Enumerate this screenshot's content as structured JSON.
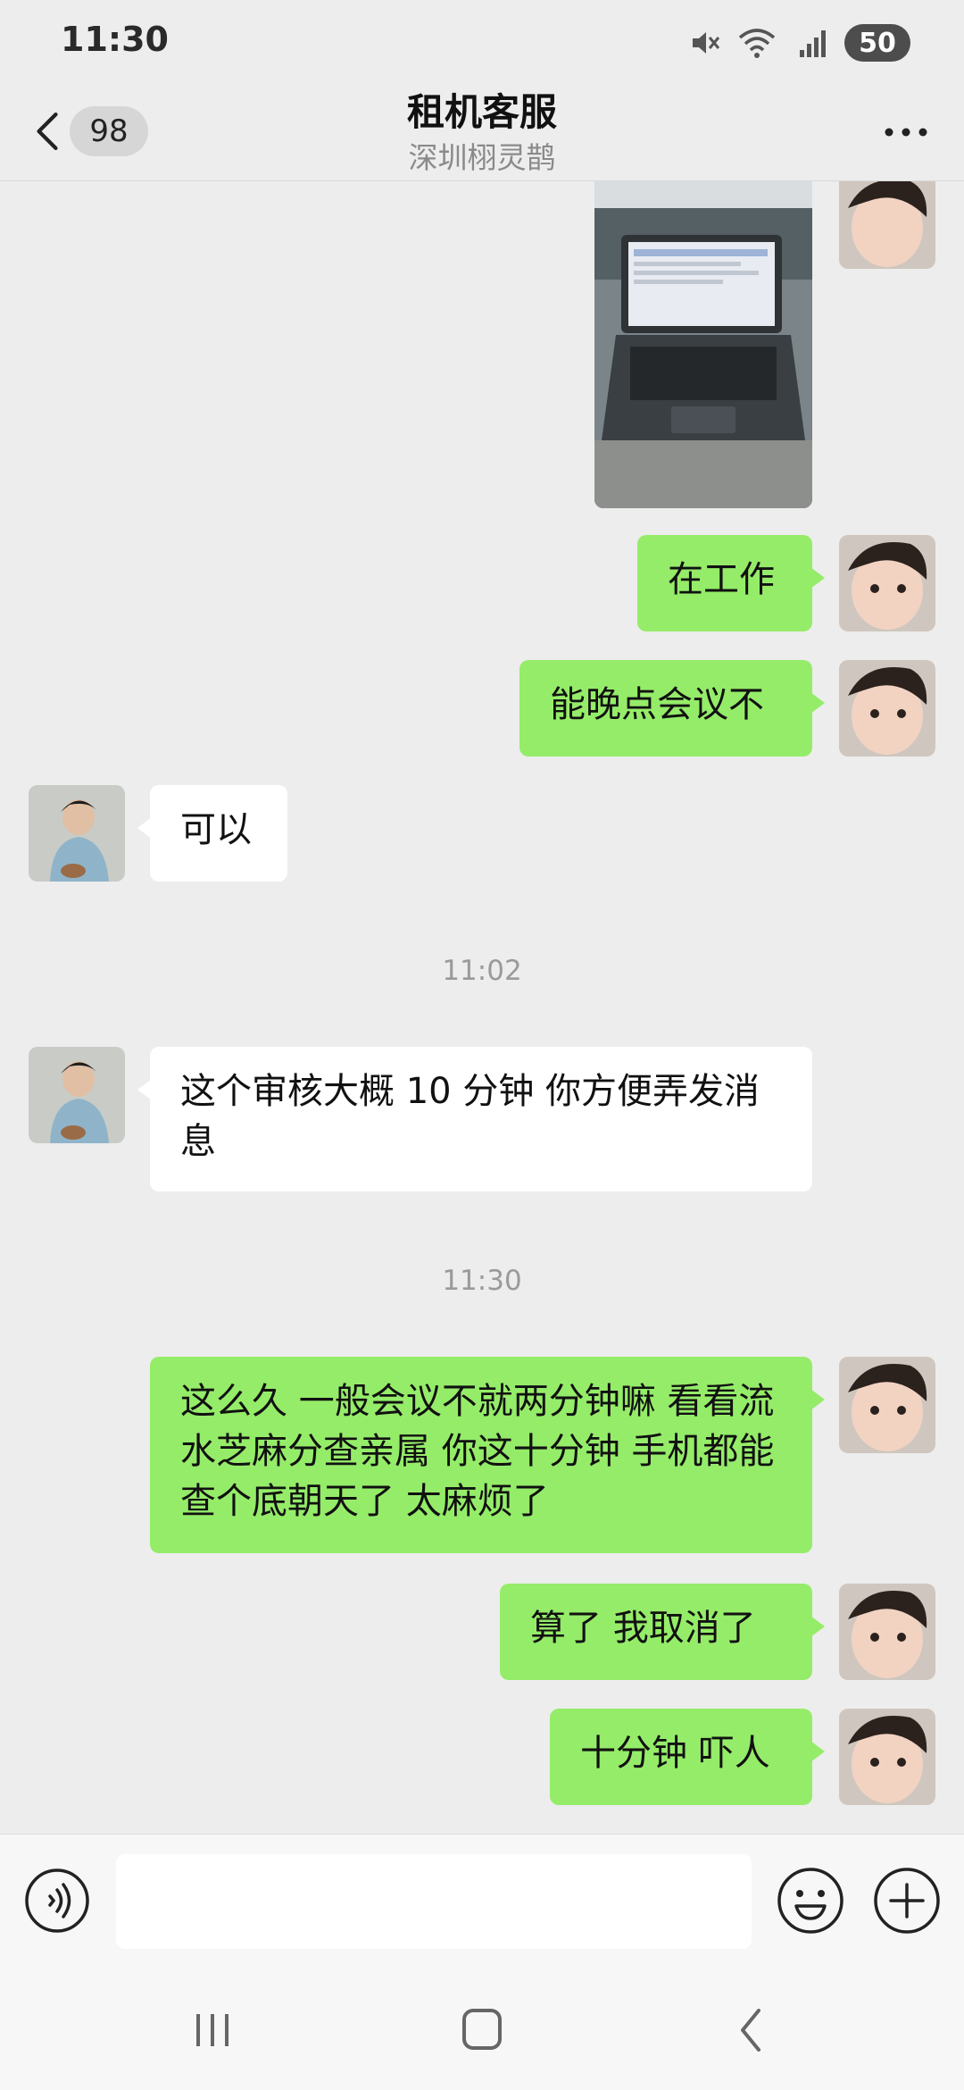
{
  "status_bar": {
    "time": "11:30",
    "battery_level": "50",
    "icons": [
      "mute-icon",
      "wifi-icon",
      "signal-4g-icon",
      "battery-icon"
    ]
  },
  "header": {
    "back_icon": "chevron-left-icon",
    "unread_count": "98",
    "title": "租机客服",
    "subtitle": "深圳栩灵鹊",
    "more_icon": "more-dots-icon"
  },
  "messages": [
    {
      "sender": "me",
      "type": "image",
      "content": "laptop-photo"
    },
    {
      "sender": "me",
      "type": "text",
      "text": "在工作"
    },
    {
      "sender": "me",
      "type": "text",
      "text": "能晚点会议不"
    },
    {
      "sender": "them",
      "type": "text",
      "text": "可以"
    },
    {
      "type": "timestamp",
      "text": "11:02"
    },
    {
      "sender": "them",
      "type": "text",
      "text": "这个审核大概 10 分钟 你方便弄发消息"
    },
    {
      "type": "timestamp",
      "text": "11:30"
    },
    {
      "sender": "me",
      "type": "text",
      "text": "这么久 一般会议不就两分钟嘛 看看流水芝麻分查亲属  你这十分钟  手机都能查个底朝天了 太麻烦了"
    },
    {
      "sender": "me",
      "type": "text",
      "text": "算了  我取消了"
    },
    {
      "sender": "me",
      "type": "text",
      "text": "十分钟 吓人"
    }
  ],
  "input_bar": {
    "value": "",
    "voice_icon": "voice-icon",
    "emoji_icon": "emoji-icon",
    "plus_icon": "plus-icon"
  },
  "nav_bar": {
    "icons": [
      "recent-apps-icon",
      "home-icon",
      "back-icon"
    ]
  },
  "colors": {
    "background": "#EDEDED",
    "my_bubble": "#95EC69",
    "their_bubble": "#FFFFFF"
  }
}
